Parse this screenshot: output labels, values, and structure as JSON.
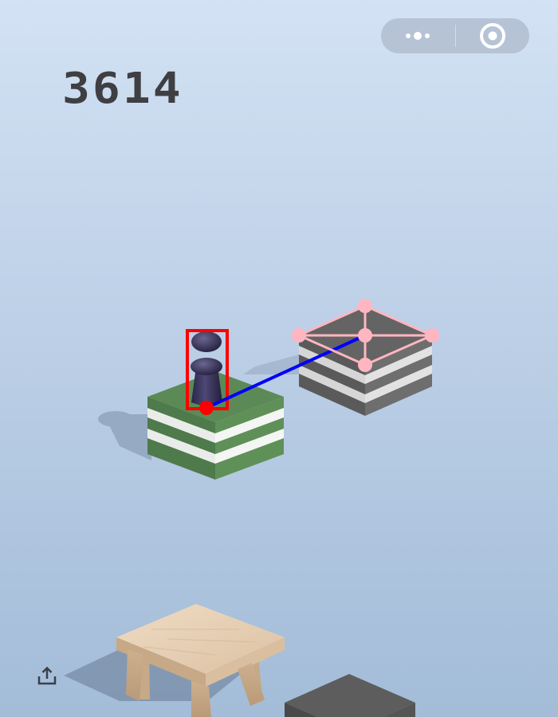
{
  "game": {
    "score": "3614"
  },
  "menu": {
    "more_icon": "more-dots-icon",
    "close_icon": "target-circle-icon"
  },
  "share": {
    "icon": "share-upload-icon"
  },
  "overlay_colors": {
    "player_box": "#ff0000",
    "jump_line": "#0000ff",
    "target_outline": "#ffb6c1"
  },
  "platform_colors": {
    "current_top": "#5c8a56",
    "target_top": "#646464",
    "stool_top": "#e8d0b4"
  }
}
